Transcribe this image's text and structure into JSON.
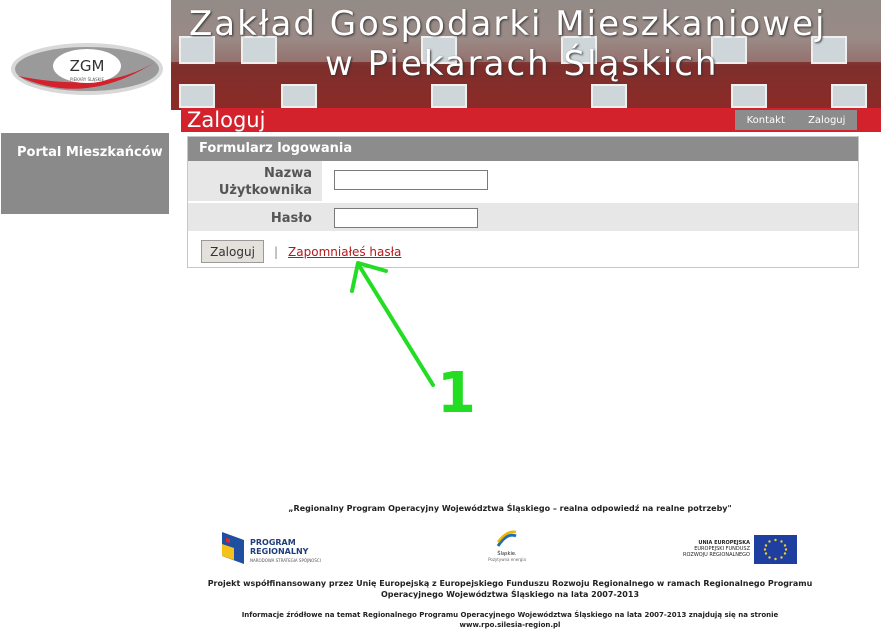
{
  "logo": {
    "text": "ZGM",
    "subtext": "PIEKARY ŚLĄSKIE"
  },
  "banner": {
    "line1": "Zakład Gospodarki Mieszkaniowej",
    "line2": "w Piekarach Śląskich"
  },
  "redbar": {
    "title": "Zaloguj"
  },
  "topnav": {
    "items": [
      "Kontakt",
      "Zaloguj"
    ]
  },
  "sidebar": {
    "items": [
      "Portal Mieszkańców"
    ]
  },
  "form": {
    "title": "Formularz logowania",
    "username_label": "Nazwa Użytkownika",
    "password_label": "Hasło",
    "username_value": "",
    "password_value": "",
    "submit_label": "Zaloguj",
    "separator": "|",
    "forgot_label": "Zapomniałeś hasła"
  },
  "annotation": {
    "number": "1",
    "color": "#22dd22"
  },
  "footer": {
    "quote": "„Regionalny Program Operacyjny Województwa Śląskiego – realna odpowiedź na realne potrzeby\"",
    "program_logo_line1": "PROGRAM",
    "program_logo_line2": "REGIONALNY",
    "program_logo_line3": "NARODOWA STRATEGIA SPÓJNOŚCI",
    "slaskie_logo_line1": "Śląskie.",
    "slaskie_logo_line2": "Pozytywna energia",
    "eu_line1": "UNIA EUROPEJSKA",
    "eu_line2": "EUROPEJSKI FUNDUSZ",
    "eu_line3": "ROZWOJU REGIONALNEGO",
    "project_line1": "Projekt współfinansowany przez Unię Europejską z Europejskiego Funduszu Rozwoju Regionalnego w ramach Regionalnego Programu",
    "project_line2": "Operacyjnego Województwa Śląskiego na lata 2007-2013",
    "info_line1": "Informacje źródłowe na temat Regionalnego Programu Operacyjnego Województwa Śląskiego na lata 2007-2013 znajdują się na stronie",
    "info_line2": "www.rpo.silesia-region.pl"
  },
  "colors": {
    "accent_red": "#d3222c",
    "gray": "#8c8c8c"
  }
}
